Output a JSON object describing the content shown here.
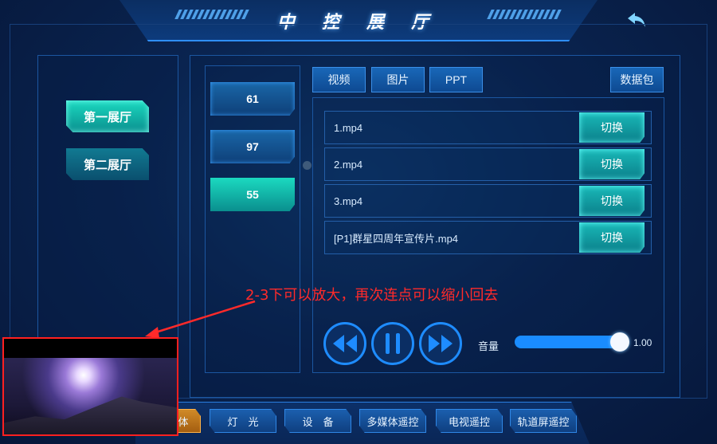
{
  "header": {
    "title": "中 控 展 厅"
  },
  "halls": [
    {
      "label": "第一展厅",
      "active": true
    },
    {
      "label": "第二展厅",
      "active": false
    }
  ],
  "devices": [
    {
      "label": "61",
      "active": false
    },
    {
      "label": "97",
      "active": false
    },
    {
      "label": "55",
      "active": true
    }
  ],
  "tabs": [
    {
      "label": "视频"
    },
    {
      "label": "图片"
    },
    {
      "label": "PPT"
    }
  ],
  "data_pack_label": "数据包",
  "files": [
    {
      "name": "1.mp4",
      "action": "切换"
    },
    {
      "name": "2.mp4",
      "action": "切换"
    },
    {
      "name": "3.mp4",
      "action": "切换"
    },
    {
      "name": "[P1]群星四周年宣传片.mp4",
      "action": "切换"
    }
  ],
  "playback": {
    "volume_label": "音量",
    "volume_value": "1.00",
    "volume_fraction": 1.0
  },
  "annotation": "2-3下可以放大，再次连点可以缩小回去",
  "bottom_nav": [
    {
      "label": "体",
      "active": true
    },
    {
      "label": "灯　光",
      "active": false
    },
    {
      "label": "设　备",
      "active": false
    },
    {
      "label": "多媒体遥控",
      "active": false
    },
    {
      "label": "电视遥控",
      "active": false
    },
    {
      "label": "轨道屏遥控",
      "active": false
    }
  ],
  "colors": {
    "accent": "#1e8cff",
    "active_teal": "#1bd9c0",
    "annotation_red": "#ff2a2a"
  }
}
